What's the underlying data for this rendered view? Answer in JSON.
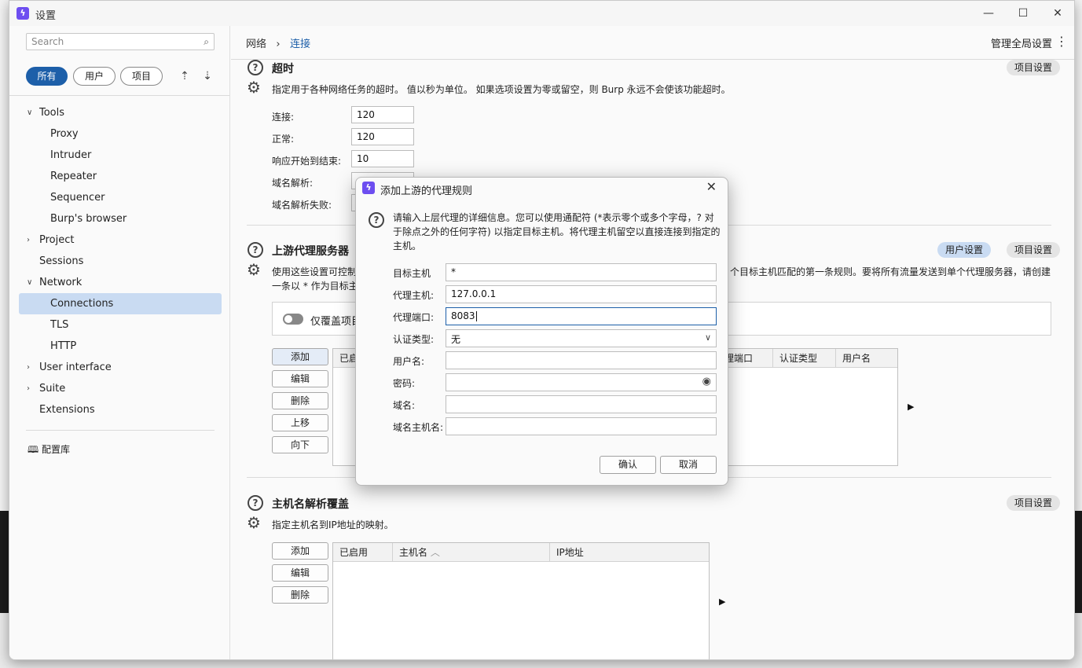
{
  "window": {
    "title": "设置",
    "minimize": "—",
    "maximize": "☐",
    "close": "✕"
  },
  "sidebar": {
    "search_placeholder": "Search",
    "filters": [
      "所有",
      "用户",
      "项目"
    ],
    "tree": [
      {
        "label": "Tools",
        "level": 0,
        "expanded": true
      },
      {
        "label": "Proxy",
        "level": 1
      },
      {
        "label": "Intruder",
        "level": 1
      },
      {
        "label": "Repeater",
        "level": 1
      },
      {
        "label": "Sequencer",
        "level": 1
      },
      {
        "label": "Burp's browser",
        "level": 1
      },
      {
        "label": "Project",
        "level": 0,
        "expanded": false
      },
      {
        "label": "Sessions",
        "level": 0
      },
      {
        "label": "Network",
        "level": 0,
        "expanded": true
      },
      {
        "label": "Connections",
        "level": 1,
        "selected": true
      },
      {
        "label": "TLS",
        "level": 1
      },
      {
        "label": "HTTP",
        "level": 1
      },
      {
        "label": "User interface",
        "level": 0,
        "expanded": false
      },
      {
        "label": "Suite",
        "level": 0,
        "expanded": false
      },
      {
        "label": "Extensions",
        "level": 0
      }
    ],
    "library": "配置库"
  },
  "header": {
    "breadcrumb_parent": "网络",
    "breadcrumb_sep": "›",
    "breadcrumb_current": "连接",
    "manage": "管理全局设置"
  },
  "timeout": {
    "title": "超时",
    "badge": "项目设置",
    "desc": "指定用于各种网络任务的超时。 值以秒为单位。 如果选项设置为零或留空，则 Burp 永远不会使该功能超时。",
    "fields": [
      {
        "label": "连接:",
        "value": "120"
      },
      {
        "label": "正常:",
        "value": "120"
      },
      {
        "label": "响应开始到结束:",
        "value": "10"
      },
      {
        "label": "域名解析:",
        "value": ""
      },
      {
        "label": "域名解析失败:",
        "value": ""
      }
    ]
  },
  "upstream": {
    "title": "上游代理服务器",
    "badge_user": "用户设置",
    "badge_project": "项目设置",
    "desc_start": "使用这些设置可控制",
    "desc_end": "个目标主机匹配的第一条规则。要将所有流量发送到单个代理服务器，请创建",
    "desc_line2": "一条以 * 作为目标主",
    "toggle_label": "仅覆盖项目",
    "buttons": [
      "添加",
      "编辑",
      "删除",
      "上移",
      "向下"
    ],
    "columns_visible": [
      "已启",
      "理端口",
      "认证类型",
      "用户名"
    ]
  },
  "hostname": {
    "title": "主机名解析覆盖",
    "badge": "项目设置",
    "desc": "指定主机名到IP地址的映射。",
    "buttons": [
      "添加",
      "编辑",
      "删除"
    ],
    "columns": [
      "已启用",
      "主机名",
      "IP地址"
    ]
  },
  "dialog": {
    "title": "添加上游的代理规则",
    "desc": "请输入上层代理的详细信息。您可以使用通配符 (*表示零个或多个字母，? 对于除点之外的任何字符) 以指定目标主机。将代理主机留空以直接连接到指定的主机。",
    "fields": [
      {
        "label": "目标主机",
        "value": "*"
      },
      {
        "label": "代理主机:",
        "value": "127.0.0.1"
      },
      {
        "label": "代理端口:",
        "value": "8083"
      },
      {
        "label": "认证类型:",
        "value": "无"
      },
      {
        "label": "用户名:",
        "value": ""
      },
      {
        "label": "密码:",
        "value": ""
      },
      {
        "label": "域名:",
        "value": ""
      },
      {
        "label": "域名主机名:",
        "value": ""
      }
    ],
    "ok": "确认",
    "cancel": "取消"
  }
}
